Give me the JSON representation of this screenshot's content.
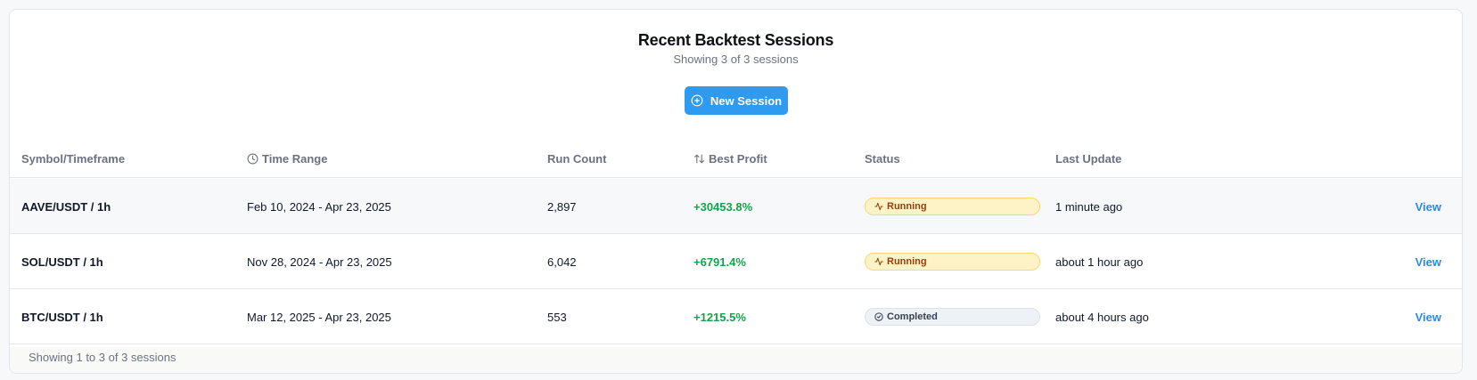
{
  "header": {
    "title": "Recent Backtest Sessions",
    "subtitle": "Showing 3 of 3 sessions",
    "new_session_label": "New Session"
  },
  "columns": {
    "symbol": "Symbol/Timeframe",
    "time_range": "Time Range",
    "run_count": "Run Count",
    "best_profit": "Best Profit",
    "status": "Status",
    "last_update": "Last Update"
  },
  "rows": [
    {
      "symbol": "AAVE/USDT / 1h",
      "time_range": "Feb 10, 2024 - Apr 23, 2025",
      "run_count": "2,897",
      "best_profit": "+30453.8%",
      "status": "Running",
      "status_icon": "activity-icon",
      "last_update": "1 minute ago",
      "action": "View"
    },
    {
      "symbol": "SOL/USDT / 1h",
      "time_range": "Nov 28, 2024 - Apr 23, 2025",
      "run_count": "6,042",
      "best_profit": "+6791.4%",
      "status": "Running",
      "status_icon": "activity-icon",
      "last_update": "about 1 hour ago",
      "action": "View"
    },
    {
      "symbol": "BTC/USDT / 1h",
      "time_range": "Mar 12, 2025 - Apr 23, 2025",
      "run_count": "553",
      "best_profit": "+1215.5%",
      "status": "Completed",
      "status_icon": "check-circle-icon",
      "last_update": "about 4 hours ago",
      "action": "View"
    }
  ],
  "footer": {
    "summary": "Showing 1 to 3 of 3 sessions"
  },
  "colors": {
    "primary": "#2e9bf0",
    "profit": "#16a34a",
    "running_bg": "#fef3c7",
    "completed_bg": "#eef2f7",
    "link": "#2e8be6"
  }
}
